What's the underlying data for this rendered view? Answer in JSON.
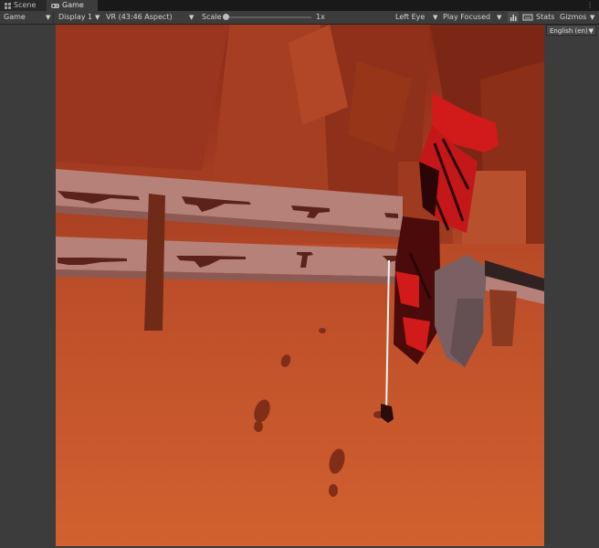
{
  "tabs": [
    {
      "label": "Scene",
      "icon": "grid-icon"
    },
    {
      "label": "Game",
      "icon": "gamepad-icon"
    }
  ],
  "toolbar": {
    "mode_dropdown": "Game",
    "display_dropdown": "Display 1",
    "aspect_dropdown": "VR (43:46 Aspect)",
    "scale_label": "Scale",
    "scale_value": "1x",
    "eye_dropdown": "Left Eye",
    "play_mode_dropdown": "Play Focused",
    "stats_label": "Stats",
    "gizmos_label": "Gizmos"
  },
  "language_dropdown": "English (en)",
  "colors": {
    "editor_bg": "#3c3c3c",
    "tabbar_bg": "#191919",
    "scene_floor": "#c2552d",
    "accent_red": "#d11a1a"
  }
}
